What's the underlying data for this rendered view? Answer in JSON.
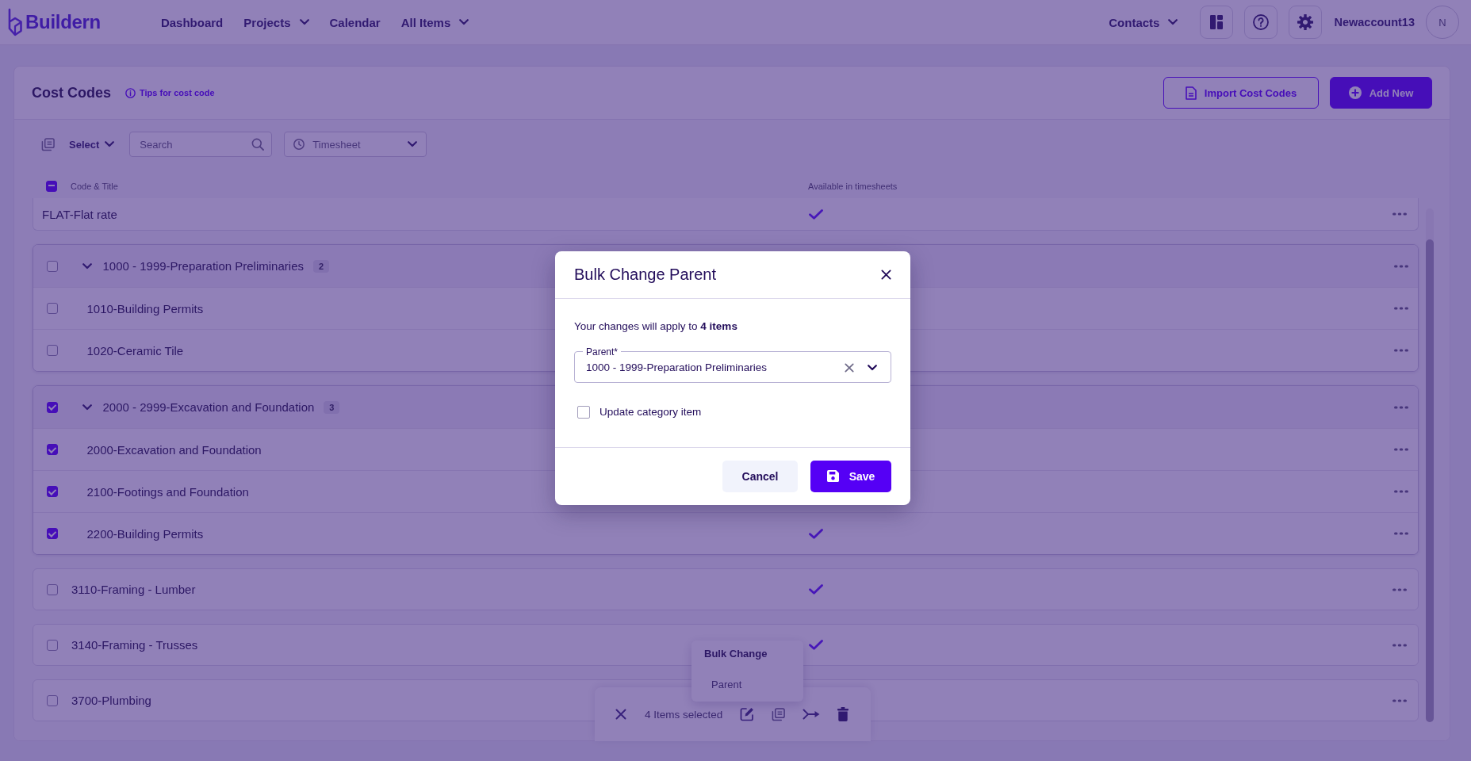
{
  "top_bar": {
    "logo": "Buildern",
    "nav": [
      {
        "label": "Dashboard",
        "dropdown": false
      },
      {
        "label": "Projects",
        "dropdown": true
      },
      {
        "label": "Calendar",
        "dropdown": false
      },
      {
        "label": "All Items",
        "dropdown": true
      }
    ],
    "contacts": {
      "label": "Contacts",
      "dropdown": true
    },
    "user": {
      "name": "Newaccount13",
      "initial": "N"
    }
  },
  "page": {
    "title": "Cost Codes",
    "tips_link": "Tips for cost code",
    "buttons": [
      {
        "kind": "outline",
        "label": "Import Cost Codes"
      },
      {
        "kind": "primary",
        "label": "Add New"
      }
    ]
  },
  "toolbar": {
    "select": "Select",
    "search": {
      "placeholder": "Search"
    },
    "timesheet_filter": {
      "placeholder": "Timesheet"
    }
  },
  "table": {
    "select_all": {
      "indeterminate": true
    },
    "columns": [
      "Code & Title",
      "Available in timesheets"
    ],
    "rows": [
      {
        "kind": "item",
        "title": "FLAT-Flat rate",
        "available": true
      },
      {
        "kind": "group",
        "title": "1000 - 1999-Preparation Preliminaries",
        "count": "2",
        "checked": false,
        "expanded": true,
        "children": [
          {
            "title": "1010-Building Permits",
            "checked": false
          },
          {
            "title": "1020-Ceramic Tile",
            "checked": false
          }
        ]
      },
      {
        "kind": "group",
        "title": "2000 - 2999-Excavation and Foundation",
        "count": "3",
        "checked": true,
        "expanded": true,
        "children": [
          {
            "title": "2000-Excavation and Foundation",
            "checked": true
          },
          {
            "title": "2100-Footings and Foundation",
            "checked": true
          },
          {
            "title": "2200-Building Permits",
            "checked": true,
            "available": true
          }
        ]
      },
      {
        "kind": "item",
        "title": "3110-Framing - Lumber",
        "checked": false,
        "available": true
      },
      {
        "kind": "item",
        "title": "3140-Framing - Trusses",
        "checked": false,
        "available": true
      },
      {
        "kind": "item",
        "title": "3700-Plumbing",
        "checked": false
      }
    ]
  },
  "bulk_menu": {
    "title": "Bulk Change",
    "items": [
      {
        "label": "Parent"
      }
    ]
  },
  "selection_bar": {
    "label": "4 Items selected"
  },
  "modal": {
    "title": "Bulk Change Parent",
    "message": "Your changes will apply to **4 items**",
    "field": {
      "label": "Parent*",
      "value": "1000 - 1999-Preparation Preliminaries"
    },
    "option": {
      "label": "Update category item",
      "checked": false
    },
    "buttons": [
      {
        "kind": "secondary",
        "label": "Cancel"
      },
      {
        "kind": "primary",
        "label": "Save"
      }
    ]
  }
}
